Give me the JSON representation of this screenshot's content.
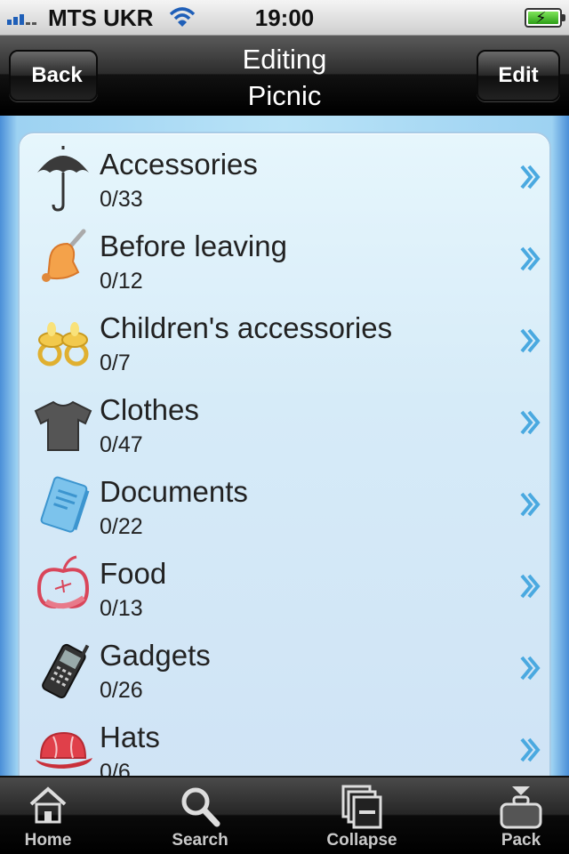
{
  "status_bar": {
    "carrier": "MTS UKR",
    "time": "19:00"
  },
  "nav": {
    "title_line1": "Editing",
    "title_line2": "Picnic",
    "back_label": "Back",
    "edit_label": "Edit"
  },
  "colors": {
    "accent": "#4aa9e0",
    "list_background": "#d6ebf8",
    "nav_bar": "#1a1a1a"
  },
  "categories": [
    {
      "name": "Accessories",
      "count": "0/33",
      "icon": "umbrella-icon"
    },
    {
      "name": "Before leaving",
      "count": "0/12",
      "icon": "bell-icon"
    },
    {
      "name": "Children's accessories",
      "count": "0/7",
      "icon": "pacifier-icon"
    },
    {
      "name": "Clothes",
      "count": "0/47",
      "icon": "tshirt-icon"
    },
    {
      "name": "Documents",
      "count": "0/22",
      "icon": "document-icon"
    },
    {
      "name": "Food",
      "count": "0/13",
      "icon": "apple-icon"
    },
    {
      "name": "Gadgets",
      "count": "0/26",
      "icon": "phone-icon"
    },
    {
      "name": "Hats",
      "count": "0/6",
      "icon": "cap-icon"
    }
  ],
  "tabs": [
    {
      "label": "Home",
      "icon": "home-icon"
    },
    {
      "label": "Search",
      "icon": "search-icon"
    },
    {
      "label": "Collapse",
      "icon": "collapse-icon"
    },
    {
      "label": "Pack",
      "icon": "pack-icon"
    }
  ]
}
